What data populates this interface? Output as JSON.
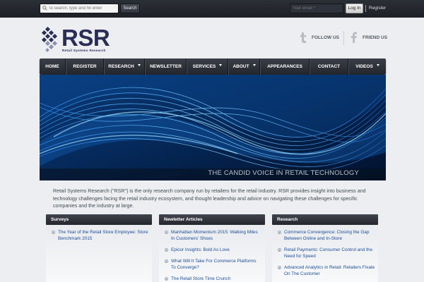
{
  "topbar": {
    "search_placeholder": "to search, type and hit enter",
    "search_button": "Search",
    "email_placeholder": "Your email *",
    "login_button": "Log In",
    "register_link": "Register"
  },
  "logo": {
    "text": "RSR",
    "subtitle": "Retail Systems Research"
  },
  "social": {
    "follow_label": "FOLLOW US",
    "friend_label": "FRIEND US"
  },
  "nav": {
    "items": [
      {
        "label": "HOME",
        "has_dropdown": false
      },
      {
        "label": "REGISTER",
        "has_dropdown": false
      },
      {
        "label": "RESEARCH",
        "has_dropdown": true
      },
      {
        "label": "NEWSLETTER",
        "has_dropdown": false
      },
      {
        "label": "SERVICES",
        "has_dropdown": true
      },
      {
        "label": "ABOUT",
        "has_dropdown": true
      },
      {
        "label": "APPEARANCES",
        "has_dropdown": false
      },
      {
        "label": "CONTACT",
        "has_dropdown": false
      },
      {
        "label": "VIDEOS",
        "has_dropdown": true
      }
    ]
  },
  "banner": {
    "tagline": "THE CANDID VOICE IN RETAIL TECHNOLOGY"
  },
  "intro": {
    "text": "Retail Systems Research (\"RSR\") is the only research company run by retailers for the retail industry. RSR provides insight into business and technology challenges facing the retail industry ecosystem, and thought leadership and advice on navigating these challenges for specific companies and the industry at large."
  },
  "columns": [
    {
      "title": "Surveys",
      "items": [
        "The Year of the Retail Store Employee: Store Benchmark 2015"
      ]
    },
    {
      "title": "Newletter Articles",
      "items": [
        "Manhattan Momentum 2015: Walking Miles In Customers' Shoes",
        "Epicor Insights: Bold As Love",
        "What Will It Take For Commerce Platforms To Converge?",
        "The Retail Store Time Crunch"
      ]
    },
    {
      "title": "Research",
      "items": [
        "Commerce Convergence: Closing the Gap Between Online and In-Store",
        "Retail Payments: Consumer Control and the Need for Speed",
        "Advanced Analytics in Retail: Retailers Fixate On The Customer"
      ]
    }
  ],
  "colors": {
    "topbar": "#1d2026",
    "page_bg": "#eceef1",
    "logo": "#2a2d55",
    "link": "#1e4e94",
    "nav": "#2c3037"
  }
}
